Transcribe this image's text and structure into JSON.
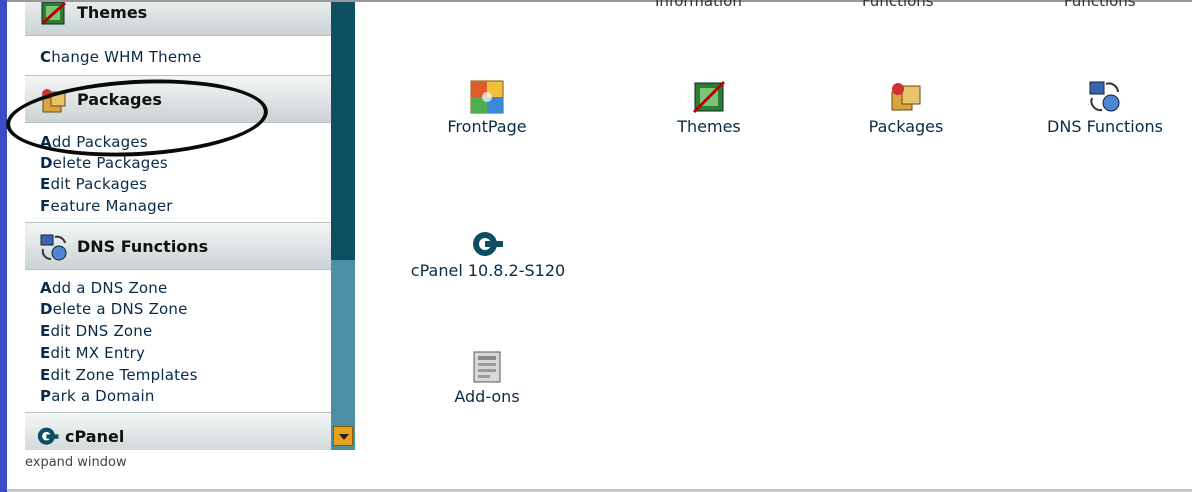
{
  "sidebar": {
    "themes": {
      "title": "Themes",
      "links": [
        "Change WHM Theme"
      ]
    },
    "packages": {
      "title": "Packages",
      "links": [
        "Add Packages",
        "Delete Packages",
        "Edit Packages",
        "Feature Manager"
      ]
    },
    "dns": {
      "title": "DNS Functions",
      "links": [
        "Add a DNS Zone",
        "Delete a DNS Zone",
        "Edit DNS Zone",
        "Edit MX Entry",
        "Edit Zone Templates",
        "Park a Domain"
      ]
    },
    "cpanel": {
      "title": "cPanel"
    },
    "expand_label": "expand window"
  },
  "main": {
    "top_cut_labels": [
      "Information",
      "Functions",
      "Functions"
    ],
    "tiles": [
      {
        "label": "FrontPage",
        "icon": "frontpage-icon"
      },
      {
        "label": "Themes",
        "icon": "themes-icon"
      },
      {
        "label": "Packages",
        "icon": "packages-icon"
      },
      {
        "label": "DNS Functions",
        "icon": "dns-functions-icon"
      },
      {
        "label": "cPanel 10.8.2-S120",
        "icon": "cpanel-logo-icon"
      },
      {
        "label": "Add-ons",
        "icon": "addons-icon"
      }
    ]
  },
  "colors": {
    "sidebar_edge": "#3b4cc7",
    "scroll_track": "#4a8fa3",
    "scroll_thumb": "#0d4f62",
    "scroll_arrow": "#e6a21a",
    "link_text": "#0a2a4a"
  }
}
